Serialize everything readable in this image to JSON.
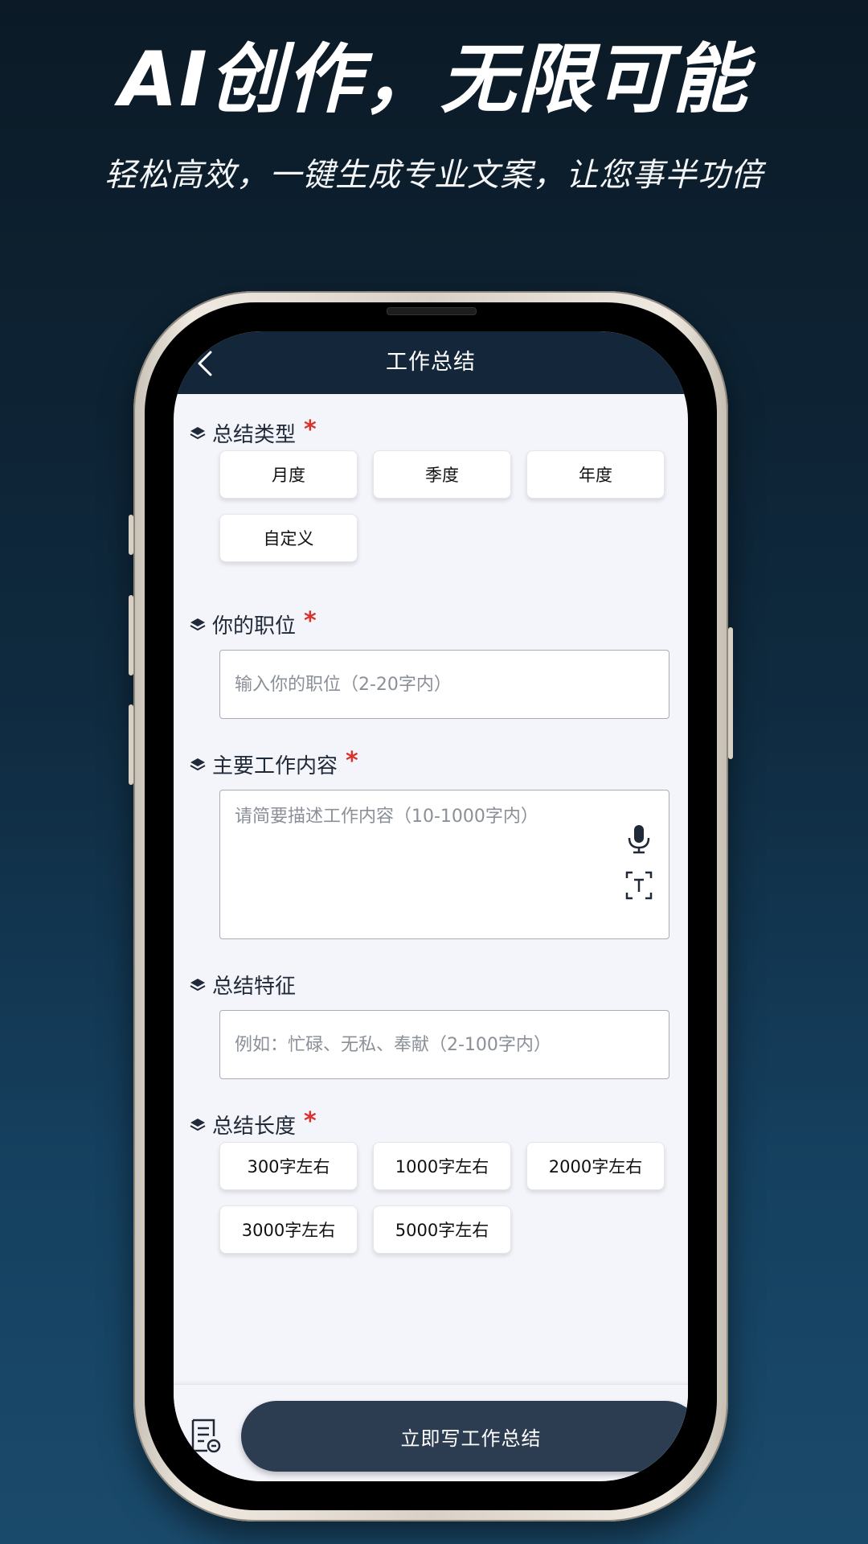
{
  "promo": {
    "title": "AI创作，无限可能",
    "subtitle": "轻松高效，一键生成专业文案，让您事半功倍"
  },
  "nav": {
    "title": "工作总结",
    "back_icon": "chevron-left-icon"
  },
  "form": {
    "summary_type": {
      "label": "总结类型",
      "required": "*",
      "options": [
        "月度",
        "季度",
        "年度",
        "自定义"
      ]
    },
    "position": {
      "label": "你的职位",
      "required": "*",
      "placeholder": "输入你的职位（2-20字内）",
      "value": ""
    },
    "work_content": {
      "label": "主要工作内容",
      "required": "*",
      "placeholder": "请简要描述工作内容（10-1000字内）",
      "value": "",
      "icons": [
        "microphone-icon",
        "text-scan-icon"
      ]
    },
    "features": {
      "label": "总结特征",
      "placeholder": "例如：忙碌、无私、奉献（2-100字内）",
      "value": ""
    },
    "length": {
      "label": "总结长度",
      "required": "*",
      "options": [
        "300字左右",
        "1000字左右",
        "2000字左右",
        "3000字左右",
        "5000字左右"
      ]
    }
  },
  "bottom": {
    "history_icon": "document-history-icon",
    "submit_label": "立即写工作总结"
  },
  "colors": {
    "nav_bg": "#14273a",
    "screen_bg": "#f4f5fb",
    "required": "#d9312c",
    "submit_bg": "#2c3d52"
  }
}
